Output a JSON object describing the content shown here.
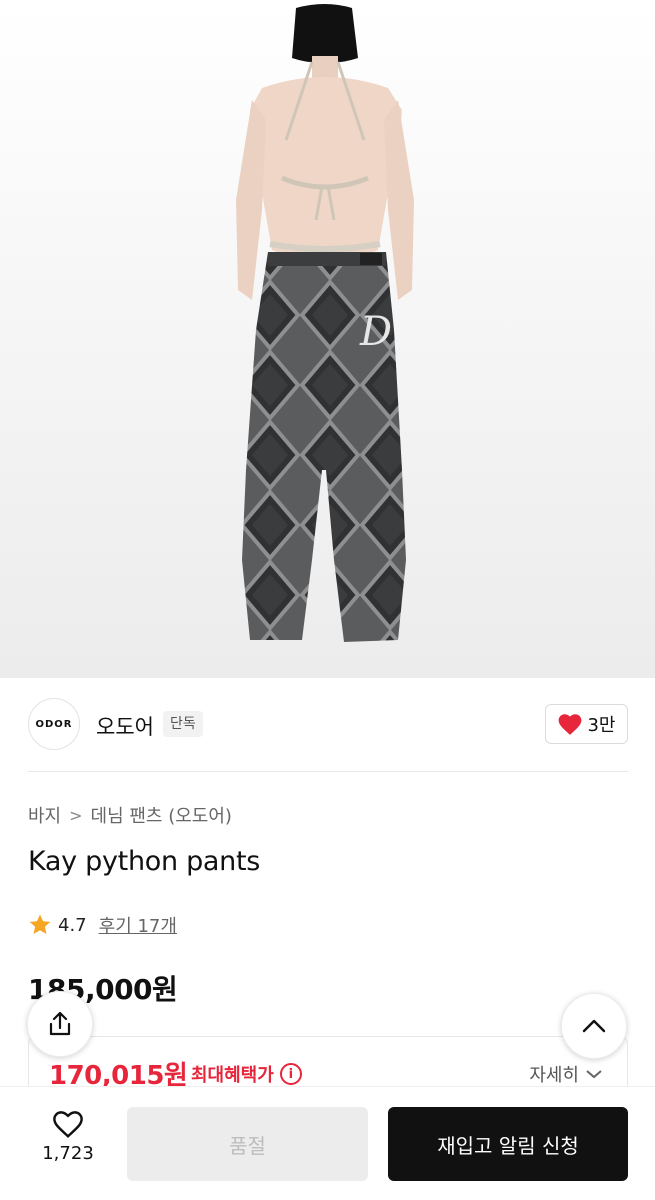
{
  "brand": {
    "logo_text": "ODOR",
    "name": "오도어",
    "badge": "단독",
    "likes": "3만"
  },
  "breadcrumb": {
    "category": "바지",
    "separator": ">",
    "subcategory": "데님 팬츠 (오도어)"
  },
  "product": {
    "title": "Kay python pants",
    "rating": "4.7",
    "reviews": "후기 17개",
    "price": "185,000원"
  },
  "benefit": {
    "price": "170,015원",
    "label": "최대혜택가",
    "detail": "자세히"
  },
  "bottom_bar": {
    "wish_count": "1,723",
    "soldout_label": "품절",
    "restock_label": "재입고 알림 신청"
  },
  "colors": {
    "accent_red": "#e8263b",
    "star": "#f5a623",
    "primary_button": "#111111",
    "disabled_button": "#ececec"
  },
  "icons": {
    "heart_filled": "heart-filled-icon",
    "heart_outline": "heart-outline-icon",
    "star": "star-icon",
    "info": "info-icon",
    "chevron_down": "chevron-down-icon",
    "share": "share-icon",
    "scroll_top": "chevron-up-icon"
  }
}
